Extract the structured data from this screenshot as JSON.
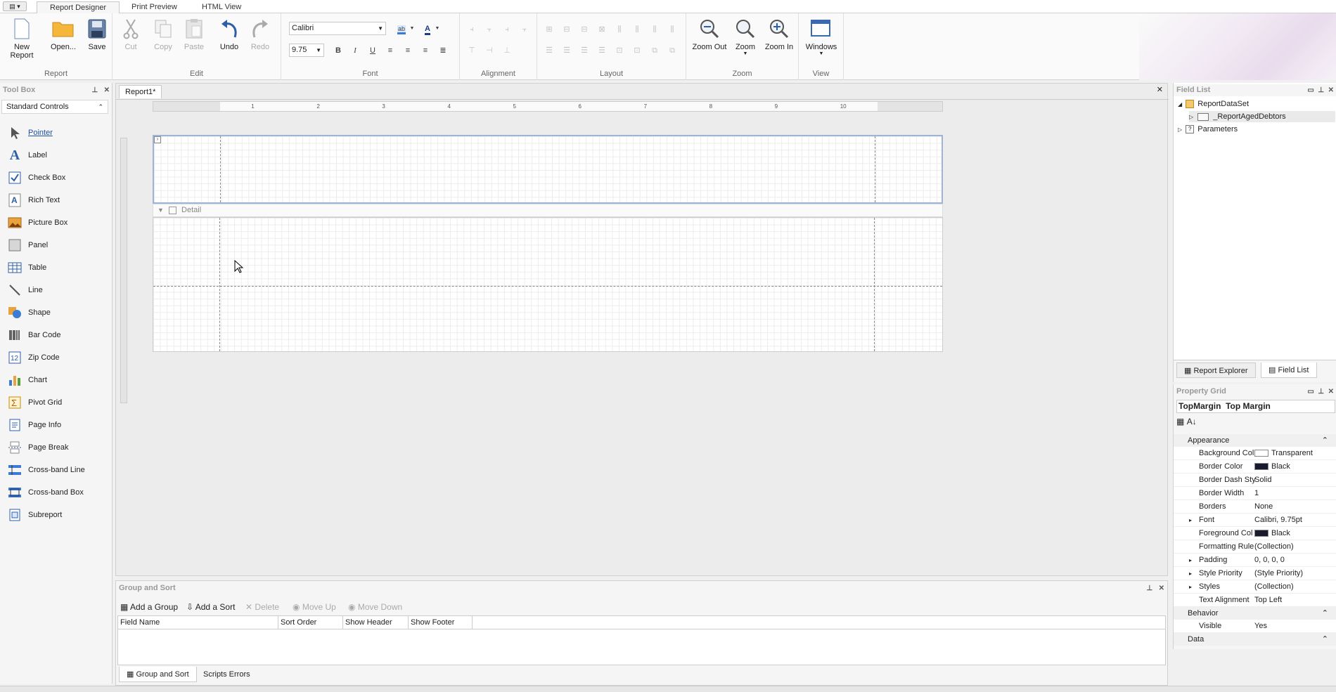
{
  "ribbon": {
    "menu_label": "▤ ▾",
    "tabs": [
      {
        "label": "Report Designer"
      },
      {
        "label": "Print Preview"
      },
      {
        "label": "HTML View"
      }
    ],
    "groups": {
      "report": {
        "title": "Report",
        "new_report": "New Report",
        "open": "Open...",
        "save": "Save"
      },
      "edit": {
        "title": "Edit",
        "cut": "Cut",
        "copy": "Copy",
        "paste": "Paste",
        "undo": "Undo",
        "redo": "Redo"
      },
      "font": {
        "title": "Font",
        "font_name": "Calibri",
        "font_size": "9.75"
      },
      "alignment": {
        "title": "Alignment"
      },
      "layout": {
        "title": "Layout"
      },
      "zoom": {
        "title": "Zoom",
        "zoom_out": "Zoom Out",
        "zoom": "Zoom",
        "zoom_in": "Zoom In"
      },
      "view": {
        "title": "View",
        "windows": "Windows"
      }
    }
  },
  "toolbox": {
    "title": "Tool Box",
    "category": "Standard Controls",
    "items": [
      {
        "label": "Pointer"
      },
      {
        "label": "Label"
      },
      {
        "label": "Check Box"
      },
      {
        "label": "Rich Text"
      },
      {
        "label": "Picture Box"
      },
      {
        "label": "Panel"
      },
      {
        "label": "Table"
      },
      {
        "label": "Line"
      },
      {
        "label": "Shape"
      },
      {
        "label": "Bar Code"
      },
      {
        "label": "Zip Code"
      },
      {
        "label": "Chart"
      },
      {
        "label": "Pivot Grid"
      },
      {
        "label": "Page Info"
      },
      {
        "label": "Page Break"
      },
      {
        "label": "Cross-band Line"
      },
      {
        "label": "Cross-band Box"
      },
      {
        "label": "Subreport"
      }
    ]
  },
  "designer": {
    "doc_tab": "Report1*",
    "detail_band": "Detail",
    "ruler_marks": [
      "1",
      "2",
      "3",
      "4",
      "5",
      "6",
      "7",
      "8",
      "9",
      "10"
    ]
  },
  "fieldlist": {
    "title": "Field List",
    "tree": [
      {
        "label": "ReportDataSet"
      },
      {
        "label": "_ReportAgedDebtors"
      },
      {
        "label": "Parameters"
      }
    ],
    "tab_explorer": "Report Explorer",
    "tab_fieldlist": "Field List"
  },
  "propgrid": {
    "title": "Property Grid",
    "object_name": "TopMargin",
    "object_type": "Top Margin",
    "categories": {
      "appearance": "Appearance",
      "behavior": "Behavior",
      "data": "Data"
    },
    "props": [
      {
        "name": "Background Col",
        "value": "Transparent"
      },
      {
        "name": "Border Color",
        "value": "Black"
      },
      {
        "name": "Border Dash Sty",
        "value": "Solid"
      },
      {
        "name": "Border Width",
        "value": "1"
      },
      {
        "name": "Borders",
        "value": "None"
      },
      {
        "name": "Font",
        "value": "Calibri, 9.75pt"
      },
      {
        "name": "Foreground Col",
        "value": "Black"
      },
      {
        "name": "Formatting Rule",
        "value": "(Collection)"
      },
      {
        "name": "Padding",
        "value": "0, 0, 0, 0"
      },
      {
        "name": "Style Priority",
        "value": "(Style Priority)"
      },
      {
        "name": "Styles",
        "value": "(Collection)"
      },
      {
        "name": "Text Alignment",
        "value": "Top Left"
      },
      {
        "name": "Visible",
        "value": "Yes"
      }
    ],
    "colors": {
      "transparent": "#ffffff",
      "black": "#1a1a2e"
    }
  },
  "groupsort": {
    "title": "Group and Sort",
    "add_group": "Add a Group",
    "add_sort": "Add a Sort",
    "delete": "Delete",
    "move_up": "Move Up",
    "move_down": "Move Down",
    "columns": [
      "Field Name",
      "Sort Order",
      "Show Header",
      "Show Footer"
    ],
    "tab_groupsort": "Group and Sort",
    "tab_scripts": "Scripts Errors"
  }
}
